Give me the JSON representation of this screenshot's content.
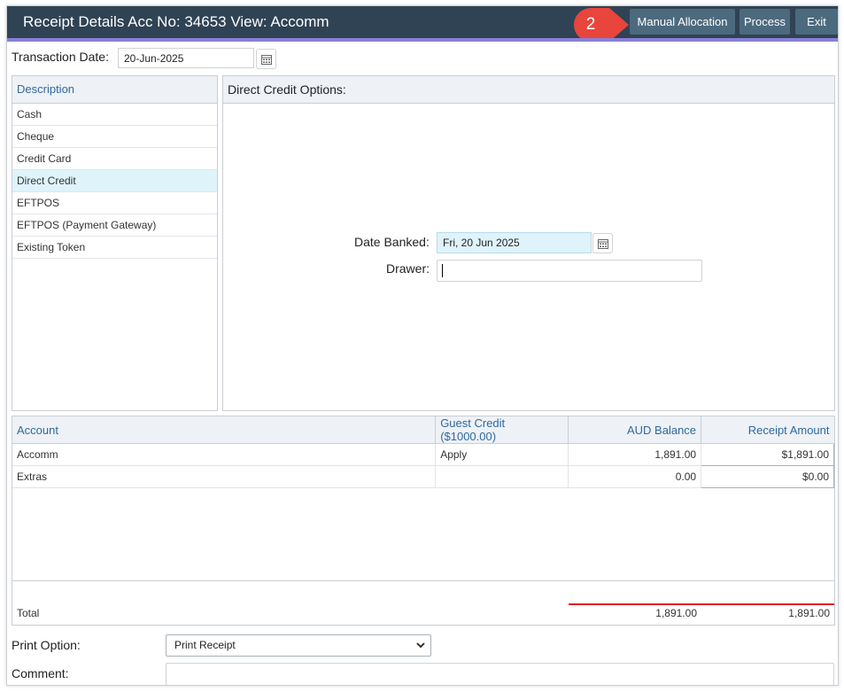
{
  "header": {
    "title": "Receipt Details Acc No: 34653 View: Accomm",
    "step_badge": "2",
    "manual_allocation_label": "Manual Allocation",
    "process_label": "Process",
    "exit_label": "Exit"
  },
  "transaction": {
    "label": "Transaction Date:",
    "value": "20-Jun-2025"
  },
  "payment_methods": {
    "header": "Description",
    "items": [
      {
        "label": "Cash"
      },
      {
        "label": "Cheque"
      },
      {
        "label": "Credit Card"
      },
      {
        "label": "Direct Credit",
        "selected": true
      },
      {
        "label": "EFTPOS"
      },
      {
        "label": "EFTPOS (Payment Gateway)"
      },
      {
        "label": "Existing Token"
      }
    ]
  },
  "options": {
    "header": "Direct Credit Options:",
    "date_banked_label": "Date Banked:",
    "date_banked_value": "Fri, 20 Jun 2025",
    "drawer_label": "Drawer:",
    "drawer_value": ""
  },
  "accounts_table": {
    "columns": [
      "Account",
      "Guest Credit ($1000.00)",
      "AUD Balance",
      "Receipt Amount"
    ],
    "rows": [
      {
        "account": "Accomm",
        "guest_credit": "Apply",
        "balance": "1,891.00",
        "receipt": "$1,891.00"
      },
      {
        "account": "Extras",
        "guest_credit": "",
        "balance": "0.00",
        "receipt": "$0.00"
      }
    ],
    "total_label": "Total",
    "total_balance": "1,891.00",
    "total_receipt": "1,891.00"
  },
  "footer": {
    "print_option_label": "Print Option:",
    "print_option_value": "Print Receipt",
    "comment_label": "Comment:",
    "comment_value": ""
  },
  "colors": {
    "titlebar": "#2f4354",
    "accent": "#8a7fd6",
    "button": "#4c6a7e",
    "badge": "#e8453c",
    "selected_row": "#dff3fb",
    "highlight_input": "#dff3fb",
    "header_text": "#2d6a9f",
    "total_line": "#e0201b"
  }
}
